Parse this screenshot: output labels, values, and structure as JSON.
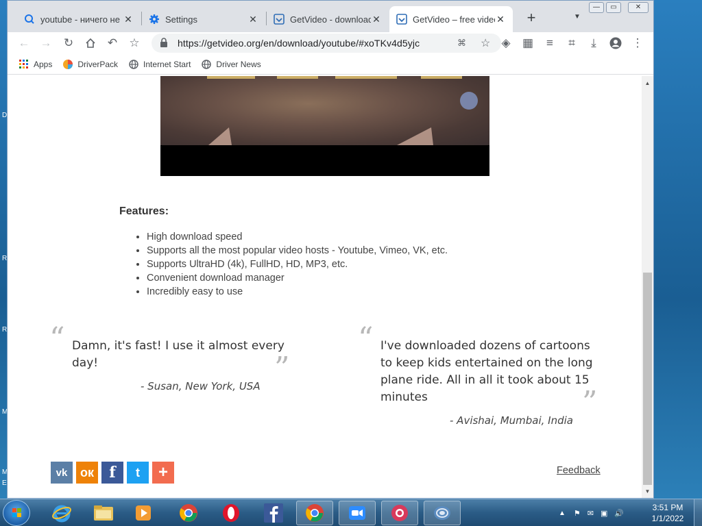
{
  "browser": {
    "tabs": [
      {
        "title": "youtube - ничего не",
        "icon": "search-tab-icon",
        "active": false
      },
      {
        "title": "Settings",
        "icon": "gear-icon",
        "active": false
      },
      {
        "title": "GetVideo - download",
        "icon": "getvideo-icon",
        "active": false
      },
      {
        "title": "GetVideo – free videc",
        "icon": "getvideo-icon",
        "active": true
      }
    ],
    "url": "https://getvideo.org/en/download/youtube/#xoTKv4d5yjc",
    "bookmarks": [
      {
        "label": "Apps",
        "icon": "apps-grid-icon"
      },
      {
        "label": "DriverPack",
        "icon": "driverpack-icon"
      },
      {
        "label": "Internet Start",
        "icon": "globe-icon"
      },
      {
        "label": "Driver News",
        "icon": "globe-icon"
      }
    ]
  },
  "page": {
    "features_title": "Features:",
    "features": [
      "High download speed",
      "Supports all the most popular video hosts - Youtube, Vimeo, VK, etc.",
      "Supports UltraHD (4k), FullHD, HD, MP3, etc.",
      "Convenient download manager",
      "Incredibly easy to use"
    ],
    "testimonials": [
      {
        "lines": [
          "Damn, it's fast! I use it almost every",
          "day!"
        ],
        "author": "- Susan, New York, USA"
      },
      {
        "lines": [
          "I've downloaded dozens of cartoons",
          "to keep kids entertained on the long",
          "plane ride. All in all it took about 15",
          "minutes"
        ],
        "author": "- Avishai, Mumbai, India"
      }
    ],
    "social": [
      {
        "name": "vk",
        "glyph": "vk",
        "color": "#5b7fa6"
      },
      {
        "name": "odnoklassniki",
        "glyph": "ок",
        "color": "#ee8208"
      },
      {
        "name": "facebook",
        "glyph": "f",
        "color": "#3b5998"
      },
      {
        "name": "twitter",
        "glyph": "t",
        "color": "#1da1f2"
      },
      {
        "name": "more",
        "glyph": "+",
        "color": "#f26c4f"
      }
    ],
    "feedback": "Feedback"
  },
  "taskbar": {
    "time": "3:51 PM",
    "date": "1/1/2022"
  },
  "desktop_letters": [
    "D",
    "R",
    "R",
    "M",
    "M",
    "E"
  ]
}
